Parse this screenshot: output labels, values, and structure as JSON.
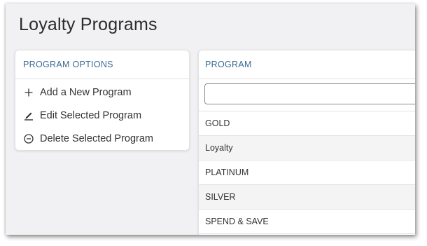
{
  "page": {
    "title": "Loyalty Programs"
  },
  "options_panel": {
    "header": "PROGRAM OPTIONS",
    "items": [
      {
        "label": "Add a New Program",
        "icon": "plus-icon"
      },
      {
        "label": "Edit Selected Program",
        "icon": "pencil-icon"
      },
      {
        "label": "Delete Selected Program",
        "icon": "minus-circle-icon"
      }
    ]
  },
  "program_table": {
    "header": "PROGRAM",
    "filter": {
      "value": "",
      "placeholder": ""
    },
    "rows": [
      "GOLD",
      "Loyalty",
      "PLATINUM",
      "SILVER",
      "SPEND & SAVE"
    ]
  },
  "colors": {
    "header_text": "#3c6a93",
    "background": "#f1f1f3",
    "row_alt": "#f4f4f5"
  }
}
